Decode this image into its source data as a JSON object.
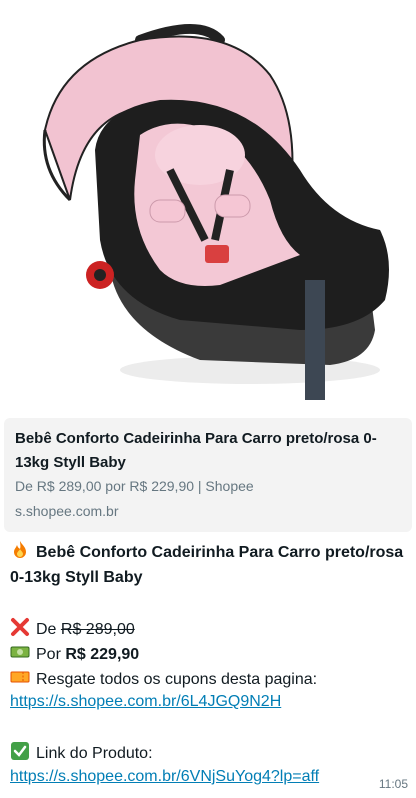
{
  "preview": {
    "title": "Bebê Conforto Cadeirinha Para Carro preto/rosa 0-13kg Styll Baby",
    "description": "De R$ 289,00 por R$ 229,90 | Shopee",
    "domain": "s.shopee.com.br"
  },
  "message": {
    "title": "Bebê Conforto Cadeirinha Para Carro preto/rosa 0-13kg Styll Baby",
    "old_price_label": "De",
    "old_price": "R$ 289,00",
    "new_price_label": "Por",
    "new_price": "R$ 229,90",
    "coupon_text": "Resgate todos os cupons desta pagina:",
    "coupon_link": "https://s.shopee.com.br/6L4JGQ9N2H",
    "product_label": "Link do Produto:",
    "product_link": "https://s.shopee.com.br/6VNjSuYog4?lp=aff",
    "time": "11:05"
  },
  "icons": {
    "fire": "fire-icon",
    "cross": "cross-mark-icon",
    "money": "dollar-banknote-icon",
    "ticket": "ticket-icon",
    "check": "check-mark-icon"
  },
  "colors": {
    "link": "#027eb5",
    "preview_bg": "#f3f3f3",
    "muted": "#667781",
    "seat_pink": "#f1c6d3",
    "seat_black": "#1c1c1c"
  }
}
